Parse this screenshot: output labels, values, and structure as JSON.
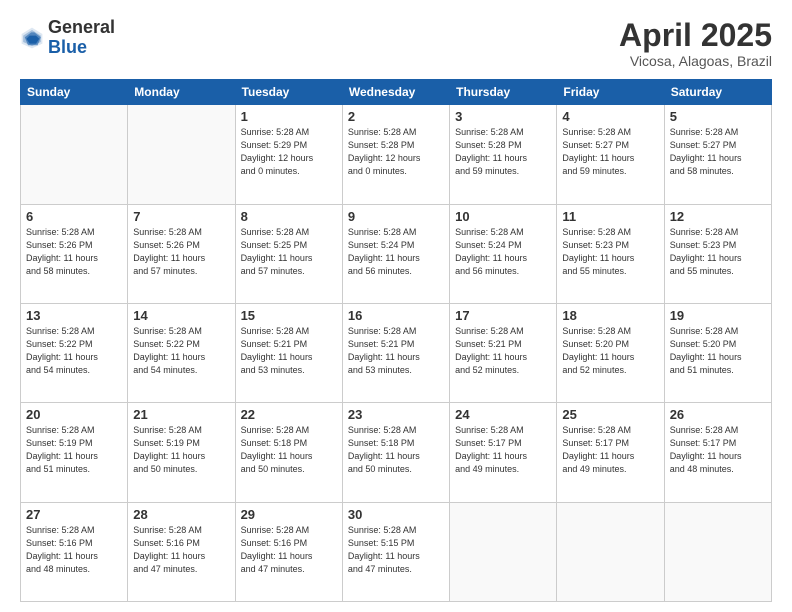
{
  "logo": {
    "general": "General",
    "blue": "Blue"
  },
  "title": "April 2025",
  "subtitle": "Vicosa, Alagoas, Brazil",
  "days_header": [
    "Sunday",
    "Monday",
    "Tuesday",
    "Wednesday",
    "Thursday",
    "Friday",
    "Saturday"
  ],
  "weeks": [
    [
      {
        "day": "",
        "info": ""
      },
      {
        "day": "",
        "info": ""
      },
      {
        "day": "1",
        "info": "Sunrise: 5:28 AM\nSunset: 5:29 PM\nDaylight: 12 hours\nand 0 minutes."
      },
      {
        "day": "2",
        "info": "Sunrise: 5:28 AM\nSunset: 5:28 PM\nDaylight: 12 hours\nand 0 minutes."
      },
      {
        "day": "3",
        "info": "Sunrise: 5:28 AM\nSunset: 5:28 PM\nDaylight: 11 hours\nand 59 minutes."
      },
      {
        "day": "4",
        "info": "Sunrise: 5:28 AM\nSunset: 5:27 PM\nDaylight: 11 hours\nand 59 minutes."
      },
      {
        "day": "5",
        "info": "Sunrise: 5:28 AM\nSunset: 5:27 PM\nDaylight: 11 hours\nand 58 minutes."
      }
    ],
    [
      {
        "day": "6",
        "info": "Sunrise: 5:28 AM\nSunset: 5:26 PM\nDaylight: 11 hours\nand 58 minutes."
      },
      {
        "day": "7",
        "info": "Sunrise: 5:28 AM\nSunset: 5:26 PM\nDaylight: 11 hours\nand 57 minutes."
      },
      {
        "day": "8",
        "info": "Sunrise: 5:28 AM\nSunset: 5:25 PM\nDaylight: 11 hours\nand 57 minutes."
      },
      {
        "day": "9",
        "info": "Sunrise: 5:28 AM\nSunset: 5:24 PM\nDaylight: 11 hours\nand 56 minutes."
      },
      {
        "day": "10",
        "info": "Sunrise: 5:28 AM\nSunset: 5:24 PM\nDaylight: 11 hours\nand 56 minutes."
      },
      {
        "day": "11",
        "info": "Sunrise: 5:28 AM\nSunset: 5:23 PM\nDaylight: 11 hours\nand 55 minutes."
      },
      {
        "day": "12",
        "info": "Sunrise: 5:28 AM\nSunset: 5:23 PM\nDaylight: 11 hours\nand 55 minutes."
      }
    ],
    [
      {
        "day": "13",
        "info": "Sunrise: 5:28 AM\nSunset: 5:22 PM\nDaylight: 11 hours\nand 54 minutes."
      },
      {
        "day": "14",
        "info": "Sunrise: 5:28 AM\nSunset: 5:22 PM\nDaylight: 11 hours\nand 54 minutes."
      },
      {
        "day": "15",
        "info": "Sunrise: 5:28 AM\nSunset: 5:21 PM\nDaylight: 11 hours\nand 53 minutes."
      },
      {
        "day": "16",
        "info": "Sunrise: 5:28 AM\nSunset: 5:21 PM\nDaylight: 11 hours\nand 53 minutes."
      },
      {
        "day": "17",
        "info": "Sunrise: 5:28 AM\nSunset: 5:21 PM\nDaylight: 11 hours\nand 52 minutes."
      },
      {
        "day": "18",
        "info": "Sunrise: 5:28 AM\nSunset: 5:20 PM\nDaylight: 11 hours\nand 52 minutes."
      },
      {
        "day": "19",
        "info": "Sunrise: 5:28 AM\nSunset: 5:20 PM\nDaylight: 11 hours\nand 51 minutes."
      }
    ],
    [
      {
        "day": "20",
        "info": "Sunrise: 5:28 AM\nSunset: 5:19 PM\nDaylight: 11 hours\nand 51 minutes."
      },
      {
        "day": "21",
        "info": "Sunrise: 5:28 AM\nSunset: 5:19 PM\nDaylight: 11 hours\nand 50 minutes."
      },
      {
        "day": "22",
        "info": "Sunrise: 5:28 AM\nSunset: 5:18 PM\nDaylight: 11 hours\nand 50 minutes."
      },
      {
        "day": "23",
        "info": "Sunrise: 5:28 AM\nSunset: 5:18 PM\nDaylight: 11 hours\nand 50 minutes."
      },
      {
        "day": "24",
        "info": "Sunrise: 5:28 AM\nSunset: 5:17 PM\nDaylight: 11 hours\nand 49 minutes."
      },
      {
        "day": "25",
        "info": "Sunrise: 5:28 AM\nSunset: 5:17 PM\nDaylight: 11 hours\nand 49 minutes."
      },
      {
        "day": "26",
        "info": "Sunrise: 5:28 AM\nSunset: 5:17 PM\nDaylight: 11 hours\nand 48 minutes."
      }
    ],
    [
      {
        "day": "27",
        "info": "Sunrise: 5:28 AM\nSunset: 5:16 PM\nDaylight: 11 hours\nand 48 minutes."
      },
      {
        "day": "28",
        "info": "Sunrise: 5:28 AM\nSunset: 5:16 PM\nDaylight: 11 hours\nand 47 minutes."
      },
      {
        "day": "29",
        "info": "Sunrise: 5:28 AM\nSunset: 5:16 PM\nDaylight: 11 hours\nand 47 minutes."
      },
      {
        "day": "30",
        "info": "Sunrise: 5:28 AM\nSunset: 5:15 PM\nDaylight: 11 hours\nand 47 minutes."
      },
      {
        "day": "",
        "info": ""
      },
      {
        "day": "",
        "info": ""
      },
      {
        "day": "",
        "info": ""
      }
    ]
  ]
}
